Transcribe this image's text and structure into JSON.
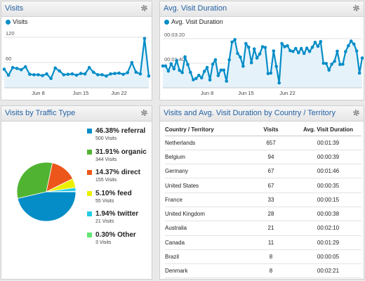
{
  "visits": {
    "title": "Visits",
    "legend": "Visits",
    "y_labels": [
      "120",
      "60"
    ],
    "x_labels": [
      "Jun 8",
      "Jun 15",
      "Jun 22"
    ],
    "accent": "#058dc7"
  },
  "avg_duration": {
    "title": "Avg. Visit Duration",
    "legend": "Avg. Visit Duration",
    "y_labels": [
      "00:03:20",
      "00:01:40"
    ],
    "x_labels": [
      "Jun 8",
      "Jun 15",
      "Jun 22"
    ],
    "accent": "#058dc7"
  },
  "traffic": {
    "title": "Visits by Traffic Type",
    "items": [
      {
        "pct": "46.38%",
        "name": "referral",
        "visits": "500 Visits",
        "color": "#058dc7"
      },
      {
        "pct": "31.91%",
        "name": "organic",
        "visits": "344 Visits",
        "color": "#50b432"
      },
      {
        "pct": "14.37%",
        "name": "direct",
        "visits": "155 Visits",
        "color": "#ed561b"
      },
      {
        "pct": "5.10%",
        "name": "feed",
        "visits": "55 Visits",
        "color": "#edef00"
      },
      {
        "pct": "1.94%",
        "name": "twitter",
        "visits": "21 Visits",
        "color": "#24cbe5"
      },
      {
        "pct": "0.30%",
        "name": "Other",
        "visits": "3 Visits",
        "color": "#64e572"
      }
    ]
  },
  "country": {
    "title": "Visits and Avg. Visit Duration by Country / Territory",
    "columns": [
      "Country / Territory",
      "Visits",
      "Avg. Visit Duration"
    ],
    "rows": [
      [
        "Netherlands",
        "657",
        "00:01:39"
      ],
      [
        "Belgium",
        "94",
        "00:00:39"
      ],
      [
        "Germany",
        "67",
        "00:01:46"
      ],
      [
        "United States",
        "67",
        "00:00:35"
      ],
      [
        "France",
        "33",
        "00:00:15"
      ],
      [
        "United Kingdom",
        "28",
        "00:00:38"
      ],
      [
        "Australia",
        "21",
        "00:02:10"
      ],
      [
        "Canada",
        "11",
        "00:01:29"
      ],
      [
        "Brazil",
        "8",
        "00:00:05"
      ],
      [
        "Denmark",
        "8",
        "00:02:21"
      ]
    ]
  },
  "chart_data": [
    {
      "type": "area",
      "title": "Visits",
      "series": [
        {
          "name": "Visits",
          "values": [
            44,
            30,
            48,
            46,
            43,
            50,
            32,
            31,
            31,
            29,
            33,
            22,
            47,
            40,
            31,
            32,
            33,
            30,
            34,
            33,
            48,
            37,
            31,
            31,
            28,
            33,
            34,
            35,
            32,
            36,
            60,
            37,
            33,
            117,
            28
          ]
        }
      ],
      "x_tick_labels": [
        "Jun 8",
        "Jun 15",
        "Jun 22"
      ],
      "y_tick_labels": [
        "120",
        "60"
      ],
      "ylim": [
        0,
        140
      ],
      "grid": true
    },
    {
      "type": "area",
      "title": "Avg. Visit Duration",
      "series": [
        {
          "name": "Avg. Visit Duration",
          "unit": "seconds",
          "values": [
            89,
            89,
            68,
            98,
            77,
            111,
            71,
            62,
            126,
            95,
            63,
            33,
            38,
            51,
            41,
            67,
            83,
            32,
            96,
            114,
            50,
            72,
            72,
            27,
            114,
            186,
            196,
            140,
            125,
            88,
            180,
            165,
            102,
            158,
            121,
            138,
            167,
            164,
            58,
            60,
            150,
            87,
            20,
            180,
            167,
            171,
            151,
            148,
            160,
            143,
            160,
            140,
            161,
            148,
            165,
            185,
            169,
            188,
            100,
            99,
            72,
            96,
            108,
            149,
            95,
            96,
            147,
            171,
            190,
            178,
            150,
            60,
            121
          ]
        }
      ],
      "x_tick_labels": [
        "Jun 8",
        "Jun 15",
        "Jun 22"
      ],
      "y_tick_labels": [
        "00:03:20",
        "00:01:40"
      ],
      "grid": true
    },
    {
      "type": "pie",
      "title": "Visits by Traffic Type",
      "slices": [
        {
          "label": "referral",
          "value": 500,
          "percent": 46.38
        },
        {
          "label": "organic",
          "value": 344,
          "percent": 31.91
        },
        {
          "label": "direct",
          "value": 155,
          "percent": 14.37
        },
        {
          "label": "feed",
          "value": 55,
          "percent": 5.1
        },
        {
          "label": "twitter",
          "value": 21,
          "percent": 1.94
        },
        {
          "label": "Other",
          "value": 3,
          "percent": 0.3
        }
      ]
    }
  ]
}
